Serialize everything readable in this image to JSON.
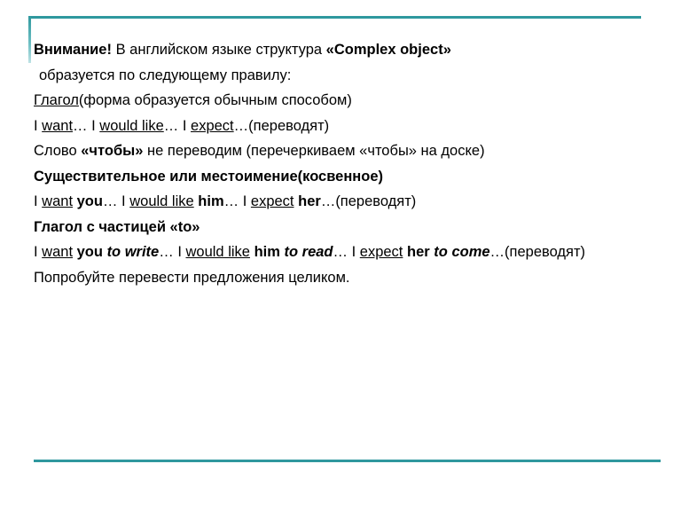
{
  "slide": {
    "decor": {
      "accent_color": "#2f989e",
      "top_rule": "horizontal-rule",
      "left_rule": "vertical-rule",
      "bottom_rule": "horizontal-rule"
    },
    "lines": [
      {
        "id": "line-attention",
        "runs": [
          {
            "text": "Внимание!",
            "style": "b"
          },
          {
            "text": " В английском языке структура ",
            "style": ""
          },
          {
            "text": "«Complex object»",
            "style": "b"
          }
        ]
      },
      {
        "id": "line-rule-intro",
        "runs": [
          {
            "text": " образуется по следующему правилу:",
            "style": ""
          }
        ]
      },
      {
        "id": "line-verb-heading",
        "runs": [
          {
            "text": "Глагол",
            "style": "u"
          },
          {
            "text": "(форма образуется обычным способом)",
            "style": ""
          }
        ]
      },
      {
        "id": "line-verb-examples",
        "runs": [
          {
            "text": "I ",
            "style": ""
          },
          {
            "text": "want",
            "style": "u"
          },
          {
            "text": "… I ",
            "style": ""
          },
          {
            "text": "would like",
            "style": "u"
          },
          {
            "text": "… I ",
            "style": ""
          },
          {
            "text": "expect",
            "style": "u"
          },
          {
            "text": "…(переводят)",
            "style": ""
          }
        ]
      },
      {
        "id": "line-chtoby",
        "runs": [
          {
            "text": "Слово ",
            "style": ""
          },
          {
            "text": "«чтобы»",
            "style": "b"
          },
          {
            "text": " не переводим (перечеркиваем «чтобы» на доске)",
            "style": ""
          }
        ]
      },
      {
        "id": "line-noun-heading",
        "runs": [
          {
            "text": "Существительное или местоимение(косвенное)",
            "style": "b"
          }
        ]
      },
      {
        "id": "line-noun-examples",
        "runs": [
          {
            "text": "I ",
            "style": ""
          },
          {
            "text": "want",
            "style": "u"
          },
          {
            "text": " ",
            "style": ""
          },
          {
            "text": "you",
            "style": "b"
          },
          {
            "text": "… I ",
            "style": ""
          },
          {
            "text": "would like",
            "style": "u"
          },
          {
            "text": " ",
            "style": ""
          },
          {
            "text": "him",
            "style": "b"
          },
          {
            "text": "… I ",
            "style": ""
          },
          {
            "text": "expect",
            "style": "u"
          },
          {
            "text": " ",
            "style": ""
          },
          {
            "text": "her",
            "style": "b"
          },
          {
            "text": "…(переводят)",
            "style": ""
          }
        ]
      },
      {
        "id": "line-to-heading",
        "runs": [
          {
            "text": "Глагол с частицей «to»",
            "style": "b"
          }
        ]
      },
      {
        "id": "line-to-examples",
        "runs": [
          {
            "text": "I ",
            "style": ""
          },
          {
            "text": "want",
            "style": "u"
          },
          {
            "text": " ",
            "style": ""
          },
          {
            "text": "you",
            "style": "b"
          },
          {
            "text": " ",
            "style": ""
          },
          {
            "text": "to write",
            "style": "bi"
          },
          {
            "text": "… I ",
            "style": ""
          },
          {
            "text": "would like",
            "style": "u"
          },
          {
            "text": " ",
            "style": ""
          },
          {
            "text": "him",
            "style": "b"
          },
          {
            "text": " ",
            "style": ""
          },
          {
            "text": "to read",
            "style": "bi"
          },
          {
            "text": "… I ",
            "style": ""
          },
          {
            "text": "expect",
            "style": "u"
          },
          {
            "text": " ",
            "style": ""
          },
          {
            "text": "her",
            "style": "b"
          },
          {
            "text": " ",
            "style": ""
          },
          {
            "text": "to come",
            "style": "bi"
          },
          {
            "text": "…(переводят)",
            "style": ""
          }
        ]
      },
      {
        "id": "line-closing",
        "runs": [
          {
            "text": "Попробуйте перевести предложения целиком.",
            "style": ""
          }
        ]
      }
    ]
  }
}
